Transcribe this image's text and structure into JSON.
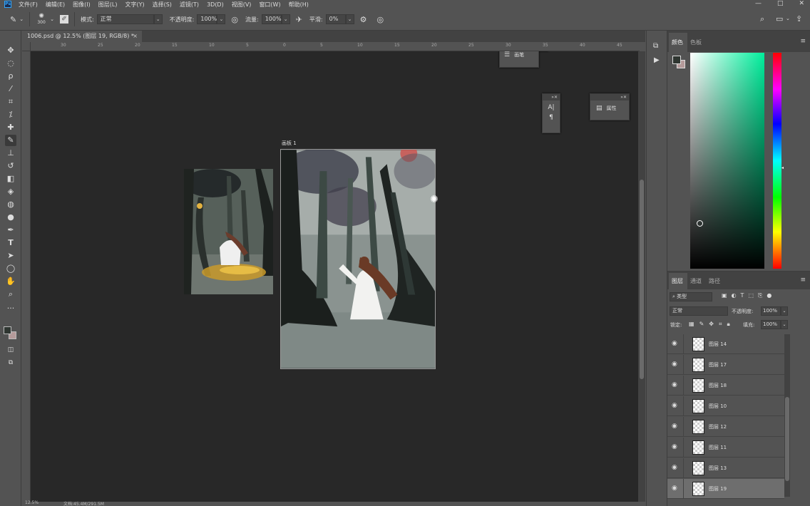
{
  "menubar": {
    "logo": "Ps",
    "items": [
      "文件(F)",
      "编辑(E)",
      "图像(I)",
      "图层(L)",
      "文字(Y)",
      "选择(S)",
      "滤镜(T)",
      "3D(D)",
      "视图(V)",
      "窗口(W)",
      "帮助(H)"
    ],
    "window_controls": [
      "—",
      "□",
      "✕"
    ]
  },
  "options": {
    "brush_size": "300",
    "mode_label": "模式:",
    "mode_value": "正常",
    "opacity_label": "不透明度:",
    "opacity_value": "100%",
    "flow_label": "流量:",
    "flow_value": "100%",
    "smoothing_label": "平滑:",
    "smoothing_value": "0%"
  },
  "document": {
    "tab_title": "1006.psd @ 12.5% (图层 19, RGB/8) *",
    "tab_close": "×",
    "artboard_label": "画板 1"
  },
  "ruler": {
    "top_labels": [
      "30",
      "25",
      "20",
      "15",
      "10",
      "5",
      "0",
      "5",
      "10",
      "15",
      "20",
      "25",
      "30",
      "35",
      "40",
      "45"
    ]
  },
  "status": {
    "zoom": "12.5%",
    "doc_info": "文档:45.4M/291.5M"
  },
  "floating_panels": {
    "brush_panel_label": "画笔",
    "character_icon": "A|",
    "paragraph_icon": "¶",
    "properties_label": "属性"
  },
  "color_panel": {
    "tabs": [
      "颜色",
      "色板"
    ],
    "accent_hue": "#00ef9c"
  },
  "layers_panel": {
    "tabs": [
      "图层",
      "通道",
      "路径"
    ],
    "filter_kind": "类型",
    "blend_mode": "正常",
    "opacity_label": "不透明度:",
    "opacity_value": "100%",
    "lock_label": "锁定:",
    "fill_label": "填充:",
    "fill_value": "100%",
    "layers": [
      {
        "name": "图层 14",
        "selected": false
      },
      {
        "name": "图层 17",
        "selected": false
      },
      {
        "name": "图层 18",
        "selected": false
      },
      {
        "name": "图层 10",
        "selected": false
      },
      {
        "name": "图层 12",
        "selected": false
      },
      {
        "name": "图层 11",
        "selected": false
      },
      {
        "name": "图层 13",
        "selected": false
      },
      {
        "name": "图层 19",
        "selected": true
      }
    ]
  }
}
